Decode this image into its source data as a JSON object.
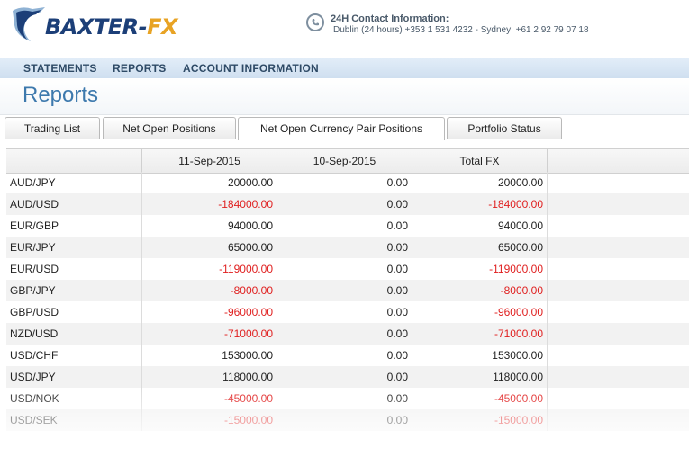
{
  "brand": {
    "logo_text_main": "BAXTER-",
    "logo_text_accent": "FX",
    "navy": "#1c3f78",
    "gold": "#e8a324"
  },
  "contact": {
    "title": "24H Contact Information:",
    "line": "Dublin (24 hours) +353 1 531 4232 - Sydney: +61 2 92 79 07 18",
    "icon": "phone-icon"
  },
  "nav": {
    "statements": "STATEMENTS",
    "reports": "REPORTS",
    "account": "ACCOUNT INFORMATION"
  },
  "page": {
    "title": "Reports"
  },
  "tabs": [
    {
      "label": "Trading List"
    },
    {
      "label": "Net Open Positions"
    },
    {
      "label": "Net Open Currency Pair Positions",
      "active": true
    },
    {
      "label": "Portfolio Status"
    }
  ],
  "table": {
    "headers": [
      "",
      "11-Sep-2015",
      "10-Sep-2015",
      "Total FX"
    ],
    "rows": [
      [
        "AUD/JPY",
        "20000.00",
        "0.00",
        "20000.00"
      ],
      [
        "AUD/USD",
        "-184000.00",
        "0.00",
        "-184000.00"
      ],
      [
        "EUR/GBP",
        "94000.00",
        "0.00",
        "94000.00"
      ],
      [
        "EUR/JPY",
        "65000.00",
        "0.00",
        "65000.00"
      ],
      [
        "EUR/USD",
        "-119000.00",
        "0.00",
        "-119000.00"
      ],
      [
        "GBP/JPY",
        "-8000.00",
        "0.00",
        "-8000.00"
      ],
      [
        "GBP/USD",
        "-96000.00",
        "0.00",
        "-96000.00"
      ],
      [
        "NZD/USD",
        "-71000.00",
        "0.00",
        "-71000.00"
      ],
      [
        "USD/CHF",
        "153000.00",
        "0.00",
        "153000.00"
      ],
      [
        "USD/JPY",
        "118000.00",
        "0.00",
        "118000.00"
      ],
      [
        "USD/NOK",
        "-45000.00",
        "0.00",
        "-45000.00"
      ],
      [
        "USD/SEK",
        "-15000.00",
        "0.00",
        "-15000.00"
      ]
    ],
    "negative_color": "#e02020"
  }
}
